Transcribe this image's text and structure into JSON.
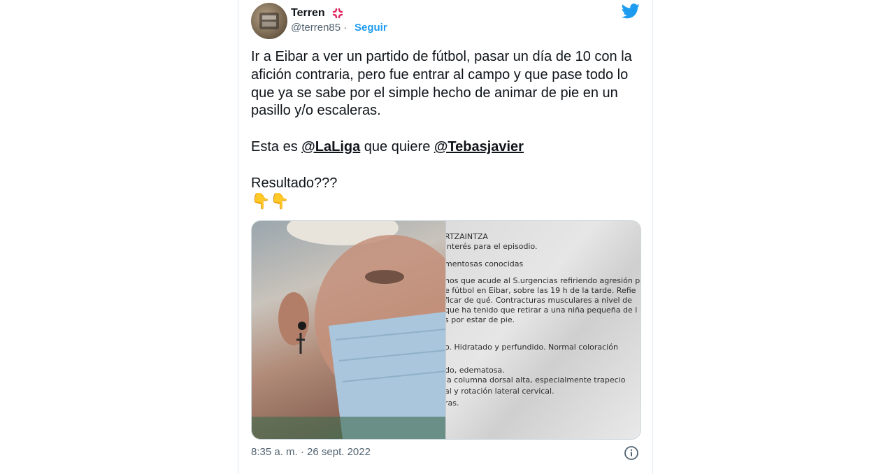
{
  "tweet": {
    "author_name": "Terren",
    "author_emoji": "anger-symbol-icon",
    "handle": "@terren85",
    "separator": "·",
    "follow_label": "Seguir",
    "text_part1": "Ir a Eibar a ver un partido de fútbol, pasar un día de 10 con la afición contraria, pero fue entrar al campo y que pase todo lo que ya se sabe por el simple hecho de animar de pie en un pasillo y/o escaleras.\n\nEsta es ",
    "mention1": "@LaLiga",
    "text_part2": " que quiere ",
    "mention2": "@Tebasjavier",
    "text_part3": "\n\nResultado???",
    "emojis": "👇👇",
    "timestamp": "8:35 a. m. · 26 sept. 2022"
  },
  "media": {
    "document_lines": [
      "RTZAINTZA",
      "interés para el episodio.",
      "mentosas conocidas",
      "nos que acude al S.urgencias refiriendo agresión po",
      "e fútbol en Eibar, sobre las 19 h de la tarde. Refie",
      "ficar de qué. Contracturas musculares a nivel de",
      "que ha tenido que retirar a una niña pequeña de l",
      "s por estar de pie.",
      "o. Hidratado y perfundido. Normal coloración",
      "do, edematosa.",
      "la columna dorsal alta, especialmente trapecio",
      "al y rotación lateral cervical.",
      "ras."
    ]
  },
  "colors": {
    "accent": "#1d9bf0",
    "text": "#0f1419",
    "muted": "#536471"
  }
}
